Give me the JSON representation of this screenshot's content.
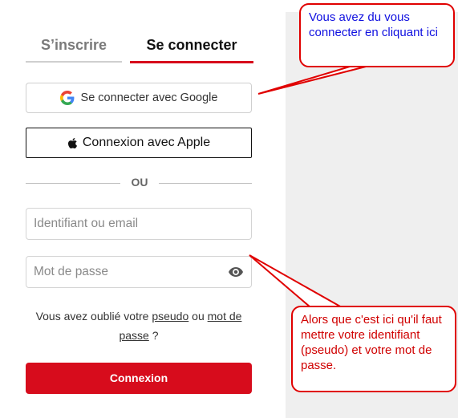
{
  "tabs": {
    "signup_label": "S’inscrire",
    "login_label": "Se connecter"
  },
  "social": {
    "google_label": "Se connecter avec Google",
    "apple_label": "Connexion avec Apple"
  },
  "divider_label": "OU",
  "form": {
    "identifier_placeholder": "Identifiant ou email",
    "password_placeholder": "Mot de passe",
    "forgot_prefix": "Vous avez oublié votre ",
    "forgot_pseudo_link": "pseudo",
    "forgot_middle": " ou ",
    "forgot_password_link": "mot de passe",
    "forgot_suffix": " ?",
    "submit_label": "Connexion"
  },
  "annotations": {
    "top_note": "Vous avez du vous connecter en cliquant ici",
    "bottom_note": "Alors que c'est ici qu'il faut mettre votre identifiant (pseudo) et votre mot de passe."
  },
  "colors": {
    "accent": "#d70c1c",
    "annotation_top_text": "#1010e0",
    "annotation_bottom_text": "#d00000"
  },
  "icons": {
    "google": "google-g-icon",
    "apple": "apple-logo-icon",
    "password_toggle": "eye-icon"
  }
}
